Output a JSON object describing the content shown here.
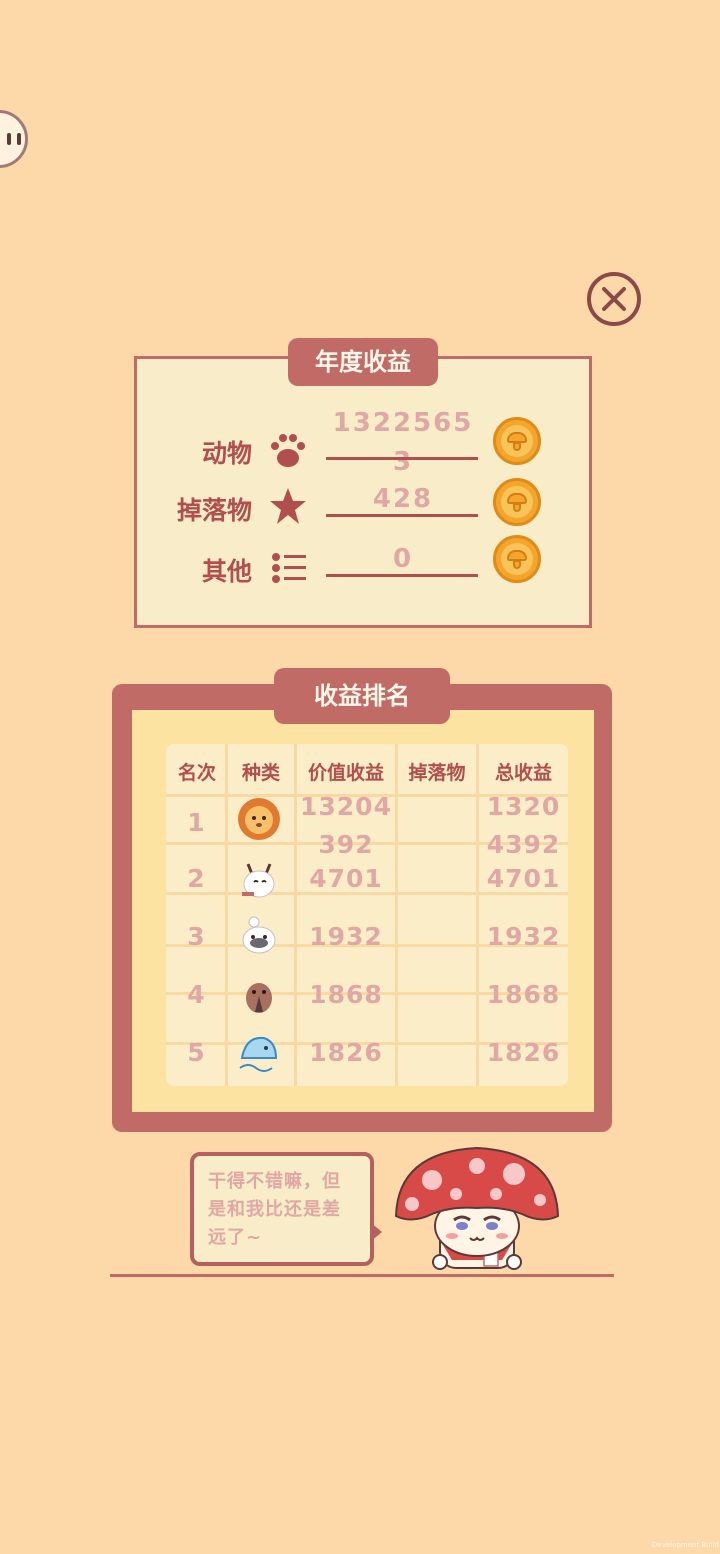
{
  "annual": {
    "title": "年度收益",
    "rows": [
      {
        "label": "动物",
        "icon": "paw-icon",
        "value_line1": "1322565",
        "value_line2": "3"
      },
      {
        "label": "掉落物",
        "icon": "star-icon",
        "value_line1": "428",
        "value_line2": ""
      },
      {
        "label": "其他",
        "icon": "list-icon",
        "value_line1": "0",
        "value_line2": ""
      }
    ]
  },
  "ranking": {
    "title": "收益排名",
    "headers": [
      "名次",
      "种类",
      "价值收益",
      "掉落物",
      "总收益"
    ],
    "rows": [
      {
        "rank": "1",
        "animal": "lion-icon",
        "value_l1": "13204",
        "value_l2": "392",
        "drop": "",
        "total_l1": "1320",
        "total_l2": "4392"
      },
      {
        "rank": "2",
        "animal": "goat-icon",
        "value_l1": "4701",
        "value_l2": "",
        "drop": "",
        "total_l1": "4701",
        "total_l2": ""
      },
      {
        "rank": "3",
        "animal": "seal-icon",
        "value_l1": "1932",
        "value_l2": "",
        "drop": "",
        "total_l1": "1932",
        "total_l2": ""
      },
      {
        "rank": "4",
        "animal": "kiwi-bird-icon",
        "value_l1": "1868",
        "value_l2": "",
        "drop": "",
        "total_l1": "1868",
        "total_l2": ""
      },
      {
        "rank": "5",
        "animal": "fish-icon",
        "value_l1": "1826",
        "value_l2": "",
        "drop": "",
        "total_l1": "1826",
        "total_l2": ""
      }
    ]
  },
  "speech": {
    "text_line1": "干得不错嘛，但",
    "text_line2": "是和我比还是差",
    "text_line3": "远了~"
  },
  "footer": {
    "build_label": "Development Build"
  },
  "colors": {
    "background": "#fdd8a8",
    "panel_border": "#c06b66",
    "panel_fill": "#f8ecc9",
    "label_text": "#b04f4d",
    "value_text": "#e0a8a4",
    "coin": "#f3a52c"
  }
}
